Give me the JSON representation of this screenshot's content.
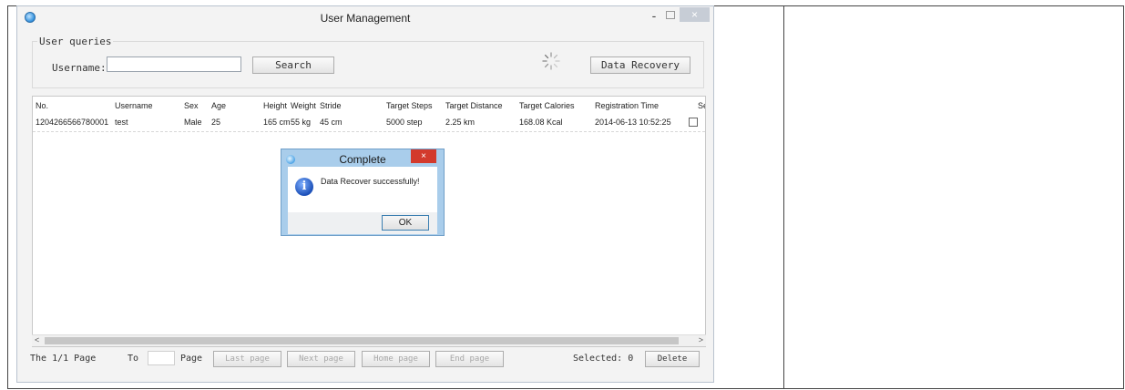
{
  "window": {
    "title": "User Management",
    "minimize": "-",
    "close": "×"
  },
  "query": {
    "group_label": "User queries",
    "username_label": "Username:",
    "username_value": "",
    "search_label": "Search",
    "recovery_label": "Data Recovery"
  },
  "table": {
    "headers": [
      "No.",
      "Username",
      "Sex",
      "Age",
      "Height",
      "Weight",
      "Stride",
      "Target Steps",
      "Target Distance",
      "Target Calories",
      "Registration Time",
      "Sele"
    ],
    "rows": [
      {
        "no": "1204266566780001",
        "username": "test",
        "sex": "Male",
        "age": "25",
        "height": "165 cm",
        "weight": "55 kg",
        "stride": "45 cm",
        "target_steps": "5000 step",
        "target_distance": "2.25 km",
        "target_calories": "168.08 Kcal",
        "registration_time": "2014-06-13 10:52:25",
        "selected": false
      }
    ],
    "scroll_left": "<",
    "scroll_right": ">"
  },
  "footer": {
    "page_info": "The 1/1 Page",
    "to_label": "To",
    "page_label": "Page",
    "page_value": "",
    "last_page": "Last page",
    "next_page": "Next page",
    "home_page": "Home page",
    "end_page": "End page",
    "selected": "Selected: 0",
    "delete": "Delete"
  },
  "dialog": {
    "title": "Complete",
    "close": "×",
    "message": "Data Recover successfully!",
    "info_glyph": "i",
    "ok": "OK"
  },
  "colors": {
    "dialog_frame": "#a9cdeb",
    "dialog_close": "#d33a2c",
    "window_bg": "#f3f3f3"
  }
}
